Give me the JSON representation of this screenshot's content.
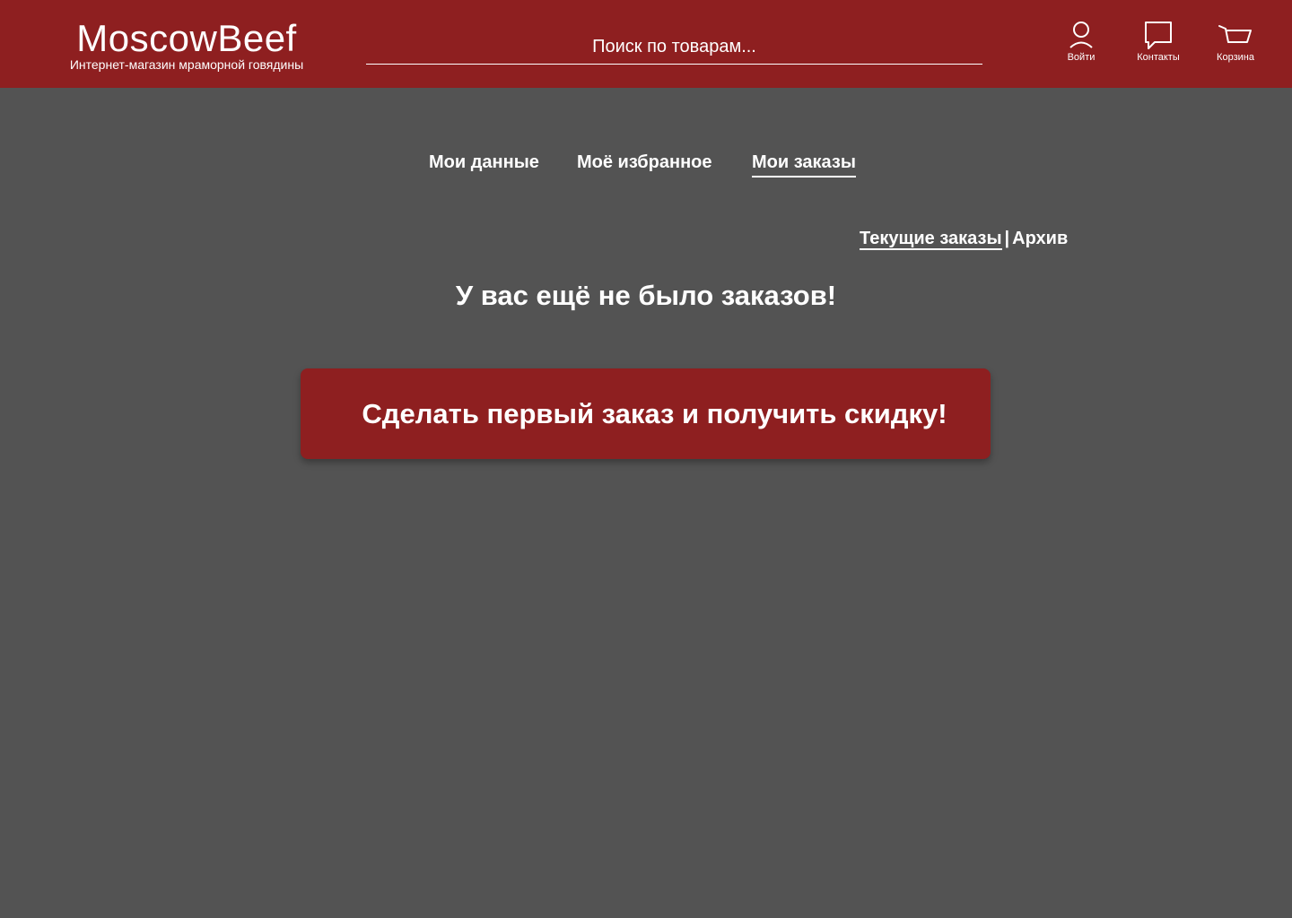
{
  "header": {
    "brand": "MoscowBeef",
    "tagline": "Интернет-магазин мраморной говядины",
    "search_placeholder": "Поиск по товарам...",
    "login_label": "Войти",
    "contacts_label": "Контакты",
    "cart_label": "Корзина",
    "login_icon": "user-icon",
    "contacts_icon": "chat-bubble-icon",
    "cart_icon": "cart-icon"
  },
  "tabs": [
    {
      "label": "Мои данные",
      "active": false
    },
    {
      "label": "Моё избранное",
      "active": false
    },
    {
      "label": "Мои заказы",
      "active": true
    }
  ],
  "orders": {
    "current_label": "Текущие заказы",
    "separator": "|",
    "archive_label": "Архив",
    "empty_message": "У вас ещё не было заказов!",
    "cta_label": "Сделать первый заказ и получить скидку!"
  },
  "colors": {
    "brand_red": "#8e1f20",
    "background": "#535353",
    "text": "#ffffff"
  }
}
